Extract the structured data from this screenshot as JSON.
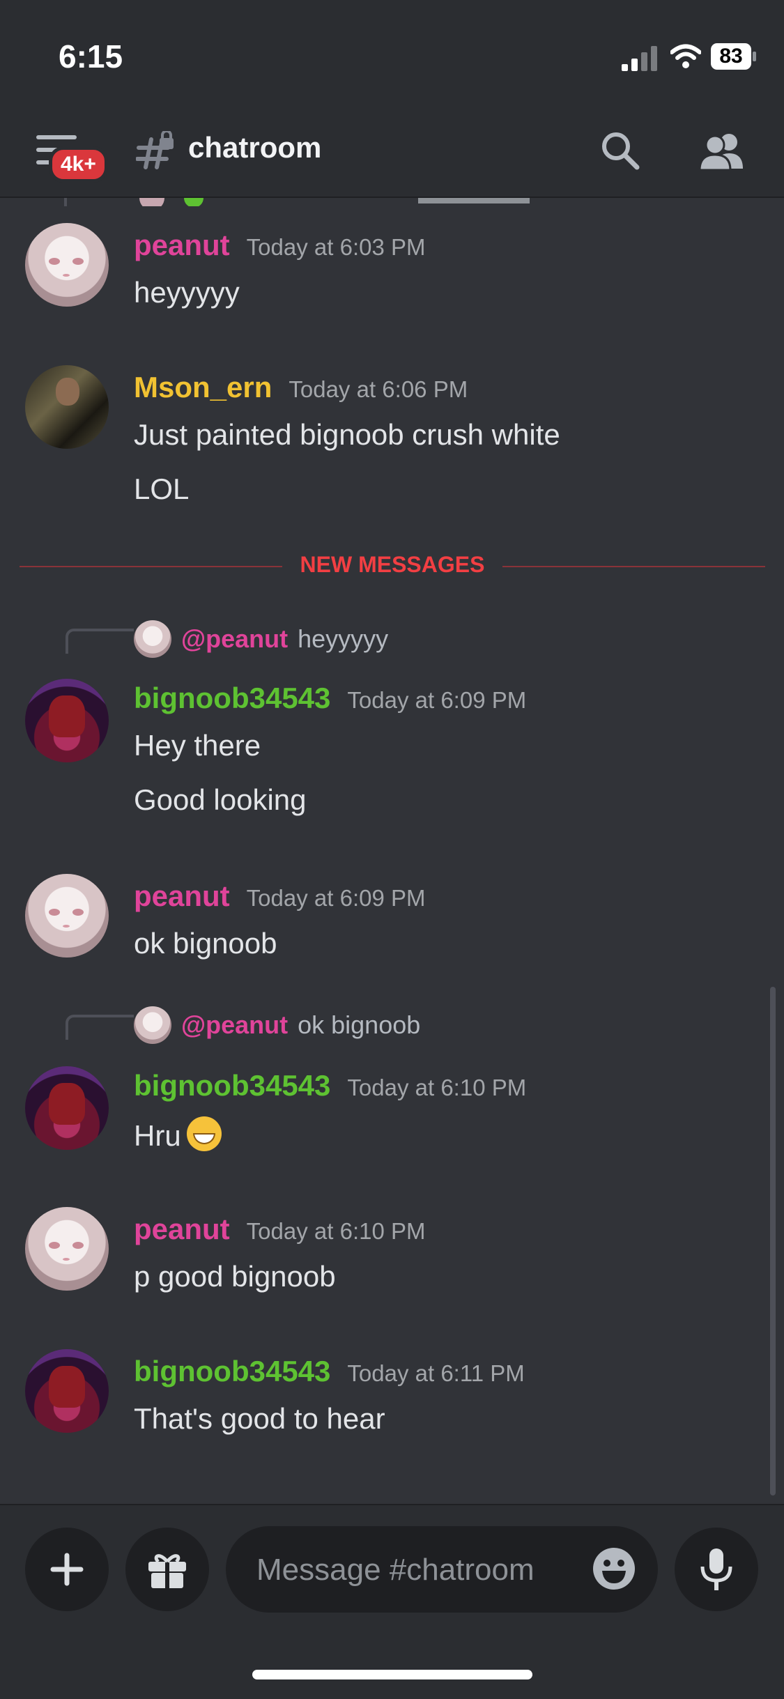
{
  "status_bar": {
    "time": "6:15",
    "battery": "83"
  },
  "header": {
    "badge": "4k+",
    "channel_name": "chatroom"
  },
  "divider_label": "NEW MESSAGES",
  "messages": [
    {
      "username": "peanut",
      "timestamp": "Today at 6:03 PM",
      "lines": [
        "heyyyyy"
      ]
    },
    {
      "username": "Mson_ern",
      "timestamp": "Today at 6:06 PM",
      "lines": [
        "Just painted bignoob crush white",
        "LOL"
      ]
    },
    {
      "reply_to": "@peanut",
      "reply_text": "heyyyyy",
      "username": "bignoob34543",
      "timestamp": "Today at 6:09 PM",
      "lines": [
        "Hey there",
        "Good looking"
      ]
    },
    {
      "username": "peanut",
      "timestamp": "Today at 6:09 PM",
      "lines": [
        "ok bignoob"
      ]
    },
    {
      "reply_to": "@peanut",
      "reply_text": "ok bignoob",
      "username": "bignoob34543",
      "timestamp": "Today at 6:10 PM",
      "lines": [
        "Hru"
      ]
    },
    {
      "username": "peanut",
      "timestamp": "Today at 6:10 PM",
      "lines": [
        "p good bignoob"
      ]
    },
    {
      "username": "bignoob34543",
      "timestamp": "Today at 6:11 PM",
      "lines": [
        "That's good to hear"
      ]
    }
  ],
  "composer": {
    "placeholder": "Message #chatroom"
  },
  "colors": {
    "background": "#313338",
    "accent_pink": "#e0449a",
    "accent_green": "#5ec232",
    "accent_yellow": "#f1c232",
    "new_messages_red": "#f23f43"
  }
}
